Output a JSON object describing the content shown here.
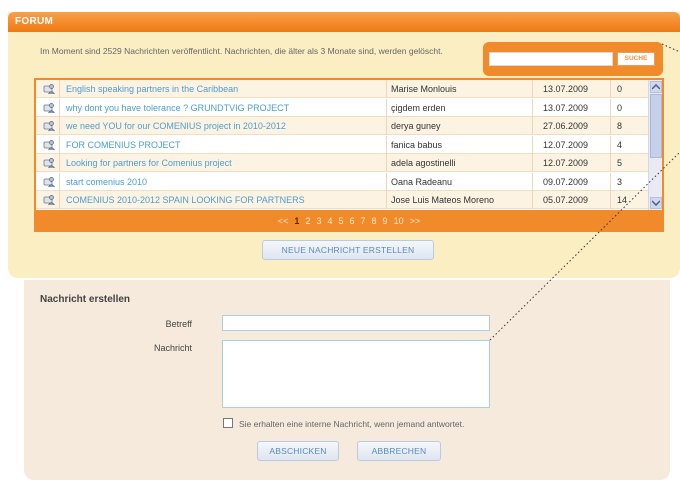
{
  "forum": {
    "title": "FORUM",
    "info": "Im Moment sind 2529 Nachrichten veröffentlicht. Nachrichten, die älter als 3 Monate sind, werden gelöscht.",
    "search": {
      "value": "",
      "button": "SUCHE"
    },
    "rows": [
      {
        "title": "English speaking partners in the Caribbean",
        "author": "Marise Monlouis",
        "date": "13.07.2009",
        "count": "0"
      },
      {
        "title": "why dont you have tolerance ? GRUNDTVIG PROJECT",
        "author": "çigdem erden",
        "date": "13.07.2009",
        "count": "0"
      },
      {
        "title": "we need YOU for our COMENIUS project in 2010-2012",
        "author": "derya guney",
        "date": "27.06.2009",
        "count": "8"
      },
      {
        "title": "FOR COMENIUS PROJECT",
        "author": "fanica babus",
        "date": "12.07.2009",
        "count": "4"
      },
      {
        "title": "Looking for partners for Comenius project",
        "author": "adela agostinelli",
        "date": "12.07.2009",
        "count": "5"
      },
      {
        "title": "start comenius 2010",
        "author": "Oana Radeanu",
        "date": "09.07.2009",
        "count": "3"
      },
      {
        "title": "COMENIUS 2010-2012 SPAIN LOOKING FOR PARTNERS",
        "author": "Jose Luis Mateos Moreno",
        "date": "05.07.2009",
        "count": "14"
      }
    ],
    "pager": {
      "prev": "<<",
      "pages": [
        "1",
        "2",
        "3",
        "4",
        "5",
        "6",
        "7",
        "8",
        "9",
        "10"
      ],
      "current": "1",
      "next": ">>"
    },
    "new_message_button": "NEUE NACHRICHT ERSTELLEN"
  },
  "compose": {
    "title": "Nachricht erstellen",
    "subject_label": "Betreff",
    "message_label": "Nachricht",
    "subject_value": "",
    "message_value": "",
    "notify_label": "Sie erhalten eine interne Nachricht, wenn jemand antwortet.",
    "send_button": "ABSCHICKEN",
    "cancel_button": "ABBRECHEN"
  },
  "colors": {
    "accent": "#f08a2a",
    "link": "#4d9ccf",
    "panel": "#fbeec2",
    "compose_panel": "#f5eadc"
  },
  "icons": {
    "row_icon": "message-user-icon",
    "scroll_up": "arrow-up-icon",
    "scroll_down": "arrow-down-icon"
  }
}
